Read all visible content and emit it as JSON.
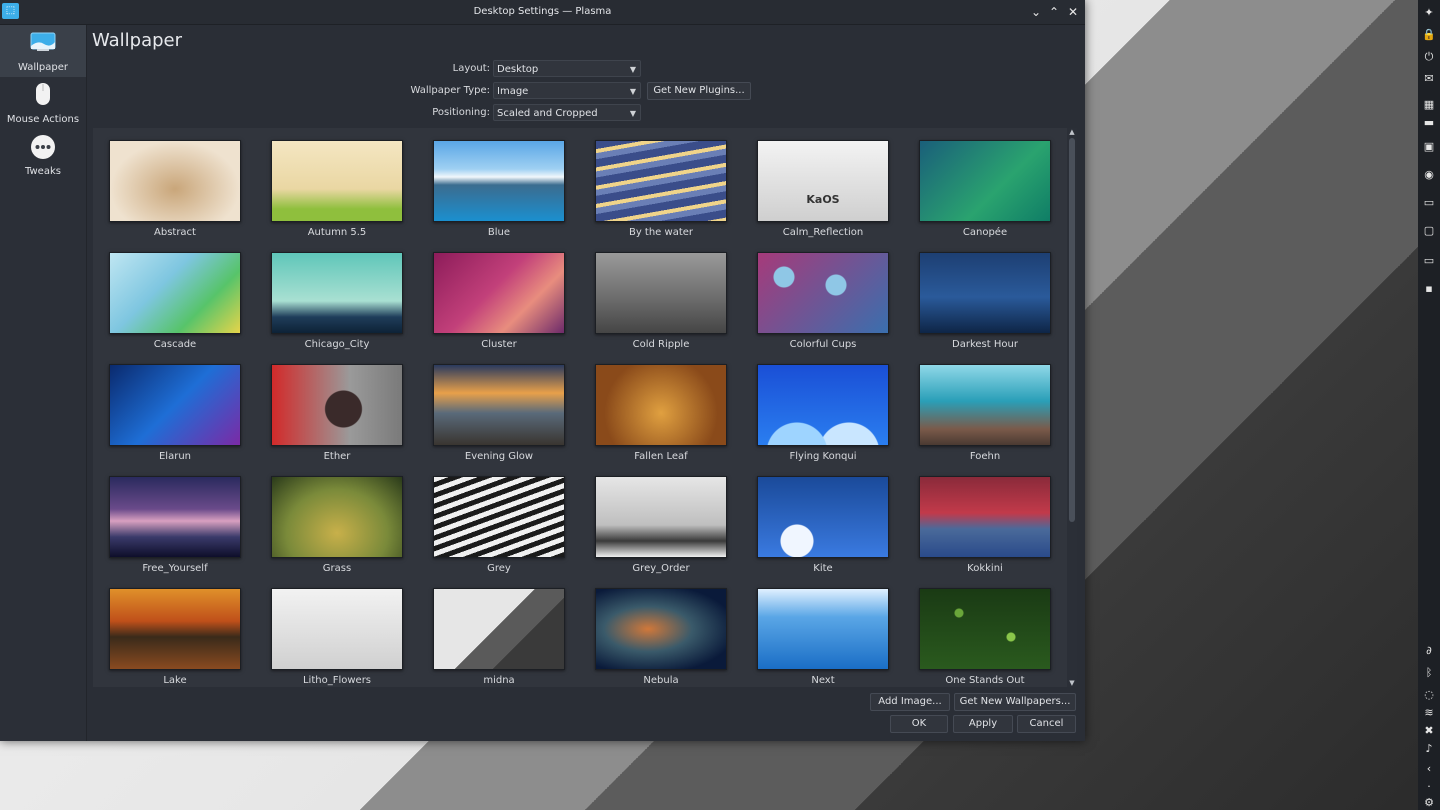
{
  "window": {
    "title": "Desktop Settings — Plasma",
    "buttons": {
      "minimize": "⌄",
      "maximize": "⌃",
      "close": "✕"
    }
  },
  "sidebar": {
    "items": [
      {
        "label": "Wallpaper",
        "icon": "wallpaper-icon",
        "active": true
      },
      {
        "label": "Mouse Actions",
        "icon": "mouse-icon",
        "active": false
      },
      {
        "label": "Tweaks",
        "icon": "tweaks-icon",
        "active": false
      }
    ]
  },
  "page": {
    "title": "Wallpaper"
  },
  "form": {
    "layout_label": "Layout:",
    "layout_value": "Desktop",
    "wallpaper_type_label": "Wallpaper Type:",
    "wallpaper_type_value": "Image",
    "get_new_plugins": "Get New Plugins...",
    "positioning_label": "Positioning:",
    "positioning_value": "Scaled and Cropped"
  },
  "wallpapers": [
    {
      "name": "Abstract"
    },
    {
      "name": "Autumn 5.5"
    },
    {
      "name": "Blue"
    },
    {
      "name": "By the water"
    },
    {
      "name": "Calm_Reflection",
      "logo": "KaOS"
    },
    {
      "name": "Canopée"
    },
    {
      "name": "Cascade"
    },
    {
      "name": "Chicago_City"
    },
    {
      "name": "Cluster"
    },
    {
      "name": "Cold Ripple"
    },
    {
      "name": "Colorful Cups"
    },
    {
      "name": "Darkest Hour"
    },
    {
      "name": "Elarun"
    },
    {
      "name": "Ether"
    },
    {
      "name": "Evening Glow"
    },
    {
      "name": "Fallen Leaf"
    },
    {
      "name": "Flying Konqui"
    },
    {
      "name": "Foehn"
    },
    {
      "name": "Free_Yourself"
    },
    {
      "name": "Grass"
    },
    {
      "name": "Grey"
    },
    {
      "name": "Grey_Order"
    },
    {
      "name": "Kite"
    },
    {
      "name": "Kokkini"
    },
    {
      "name": "Lake"
    },
    {
      "name": "Litho_Flowers"
    },
    {
      "name": "midna"
    },
    {
      "name": "Nebula"
    },
    {
      "name": "Next"
    },
    {
      "name": "One Stands Out"
    }
  ],
  "buttons": {
    "add_image": "Add Image...",
    "get_new_wallpapers": "Get New Wallpapers...",
    "ok": "OK",
    "apply": "Apply",
    "cancel": "Cancel"
  },
  "panel": {
    "icons": [
      "kaos-icon",
      "lock-icon",
      "power-icon",
      "notes-icon",
      "apps-icon",
      "pager-icon",
      "folder-icon",
      "browser-icon",
      "terminal-icon",
      "files-icon",
      "monitor-icon",
      "settings-app-icon",
      "clipboard-icon",
      "bluetooth-icon",
      "ghost-icon",
      "wifi-icon",
      "notifications-icon",
      "volume-icon",
      "expand-icon",
      "clock-icon",
      "gear-icon"
    ]
  }
}
